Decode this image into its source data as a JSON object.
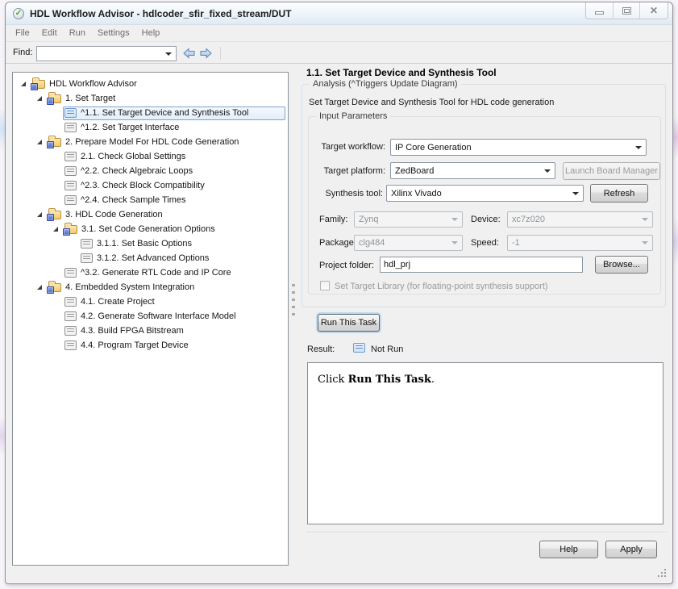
{
  "window": {
    "title": "HDL Workflow Advisor - hdlcoder_sfir_fixed_stream/DUT"
  },
  "icons": {
    "advisor_check": "✓",
    "close": "✕"
  },
  "menu": {
    "items": [
      "File",
      "Edit",
      "Run",
      "Settings",
      "Help"
    ]
  },
  "findbar": {
    "label": "Find:",
    "value": "",
    "placeholder": ""
  },
  "tree": {
    "items": [
      {
        "label": "HDL Workflow Advisor",
        "level": 0,
        "kind": "folder",
        "expanded": true,
        "selected": false
      },
      {
        "label": "1. Set Target",
        "level": 1,
        "kind": "folder",
        "expanded": true,
        "selected": false
      },
      {
        "label": "^1.1. Set Target Device and Synthesis Tool",
        "level": 2,
        "kind": "task",
        "selected": true
      },
      {
        "label": "^1.2. Set Target Interface",
        "level": 2,
        "kind": "task",
        "selected": false
      },
      {
        "label": "2. Prepare Model For HDL Code Generation",
        "level": 1,
        "kind": "folder",
        "expanded": true,
        "selected": false
      },
      {
        "label": "2.1. Check Global Settings",
        "level": 2,
        "kind": "task",
        "selected": false
      },
      {
        "label": "^2.2. Check Algebraic Loops",
        "level": 2,
        "kind": "task",
        "selected": false
      },
      {
        "label": "^2.3. Check Block Compatibility",
        "level": 2,
        "kind": "task",
        "selected": false
      },
      {
        "label": "^2.4. Check Sample Times",
        "level": 2,
        "kind": "task",
        "selected": false
      },
      {
        "label": "3. HDL Code Generation",
        "level": 1,
        "kind": "folder",
        "expanded": true,
        "selected": false
      },
      {
        "label": "3.1. Set Code Generation Options",
        "level": 2,
        "kind": "folder",
        "expanded": true,
        "selected": false
      },
      {
        "label": "3.1.1. Set Basic Options",
        "level": 3,
        "kind": "task",
        "selected": false
      },
      {
        "label": "3.1.2. Set Advanced Options",
        "level": 3,
        "kind": "task",
        "selected": false
      },
      {
        "label": "^3.2. Generate RTL Code and IP Core",
        "level": 2,
        "kind": "task",
        "selected": false
      },
      {
        "label": "4. Embedded System Integration",
        "level": 1,
        "kind": "folder",
        "expanded": true,
        "selected": false
      },
      {
        "label": "4.1. Create Project",
        "level": 2,
        "kind": "task",
        "selected": false
      },
      {
        "label": "4.2. Generate Software Interface Model",
        "level": 2,
        "kind": "task",
        "selected": false
      },
      {
        "label": "4.3. Build FPGA Bitstream",
        "level": 2,
        "kind": "task",
        "selected": false
      },
      {
        "label": "4.4. Program Target Device",
        "level": 2,
        "kind": "task",
        "selected": false
      }
    ]
  },
  "panel": {
    "title": "1.1. Set Target Device and Synthesis Tool",
    "analysis_legend": "Analysis (^Triggers Update Diagram)",
    "description": "Set Target Device and Synthesis Tool for HDL code generation",
    "input_legend": "Input Parameters",
    "fields": {
      "target_workflow": {
        "label": "Target workflow:",
        "value": "IP Core Generation"
      },
      "target_platform": {
        "label": "Target platform:",
        "value": "ZedBoard"
      },
      "launch_board_manager_label": "Launch Board Manager",
      "synthesis_tool": {
        "label": "Synthesis tool:",
        "value": "Xilinx Vivado"
      },
      "refresh_label": "Refresh",
      "family": {
        "label": "Family:",
        "value": "Zynq"
      },
      "device": {
        "label": "Device:",
        "value": "xc7z020"
      },
      "package": {
        "label": "Package:",
        "value": "clg484"
      },
      "speed": {
        "label": "Speed:",
        "value": "-1"
      },
      "project_folder": {
        "label": "Project folder:",
        "value": "hdl_prj"
      },
      "browse_label": "Browse...",
      "set_target_library_label": "Set Target Library (for floating-point synthesis support)"
    },
    "run_button_label": "Run This Task",
    "result": {
      "label": "Result:",
      "status": "Not Run"
    },
    "message": {
      "prefix": "Click ",
      "bold": "Run This Task",
      "suffix": "."
    },
    "help_button_label": "Help",
    "apply_button_label": "Apply"
  },
  "colors": {
    "selection_border": "#7da2ce",
    "task_icon_blue": "#6b9bd2",
    "folder_yellow": "#f3c969",
    "titlebar_tint": "#e0eaf3",
    "panel_bg": "#f0f0f0"
  }
}
